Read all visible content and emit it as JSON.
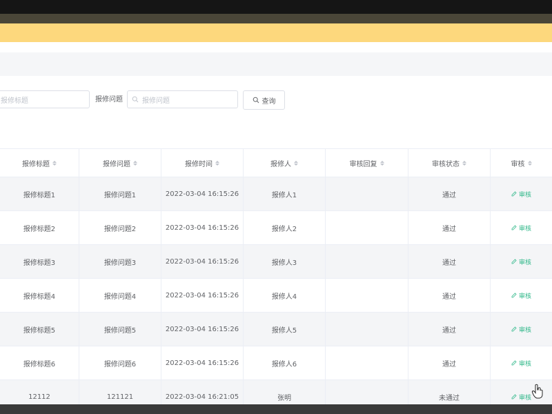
{
  "search": {
    "title_placeholder": "报修标题",
    "problem_label": "报修问题",
    "problem_placeholder": "报修问题",
    "query_button": "查询"
  },
  "table": {
    "columns": [
      "报修标题",
      "报修问题",
      "报修时间",
      "报修人",
      "审核回复",
      "审核状态",
      "审核"
    ],
    "rows": [
      {
        "title": "报修标题1",
        "problem": "报修问题1",
        "time": "2022-03-04 16:15:26",
        "person": "报修人1",
        "reply": "",
        "status": "通过",
        "action": "审核"
      },
      {
        "title": "报修标题2",
        "problem": "报修问题2",
        "time": "2022-03-04 16:15:26",
        "person": "报修人2",
        "reply": "",
        "status": "通过",
        "action": "审核"
      },
      {
        "title": "报修标题3",
        "problem": "报修问题3",
        "time": "2022-03-04 16:15:26",
        "person": "报修人3",
        "reply": "",
        "status": "通过",
        "action": "审核"
      },
      {
        "title": "报修标题4",
        "problem": "报修问题4",
        "time": "2022-03-04 16:15:26",
        "person": "报修人4",
        "reply": "",
        "status": "通过",
        "action": "审核"
      },
      {
        "title": "报修标题5",
        "problem": "报修问题5",
        "time": "2022-03-04 16:15:26",
        "person": "报修人5",
        "reply": "",
        "status": "通过",
        "action": "审核"
      },
      {
        "title": "报修标题6",
        "problem": "报修问题6",
        "time": "2022-03-04 16:15:26",
        "person": "报修人6",
        "reply": "",
        "status": "通过",
        "action": "审核"
      },
      {
        "title": "12112",
        "problem": "121121",
        "time": "2022-03-04 16:21:05",
        "person": "张明",
        "reply": "",
        "status": "未通过",
        "action": "审核"
      }
    ]
  },
  "icons": {
    "search": "search-icon",
    "sort": "sort-icon",
    "edit": "edit-icon",
    "cursor": "hand-cursor-icon"
  },
  "colors": {
    "banner": "#fdd87d",
    "action": "#31b88a",
    "row_alt": "#f4f5f7"
  }
}
